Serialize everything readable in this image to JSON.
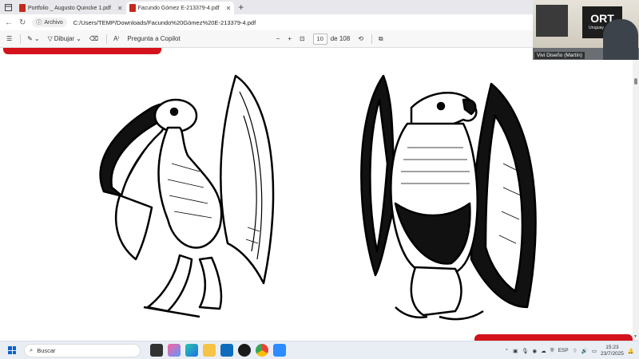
{
  "tabs": [
    {
      "title": "Portfolio _ Augusto Quincke 1.pdf",
      "active": false
    },
    {
      "title": "Facundo Gómez E-213379-4.pdf",
      "active": true
    }
  ],
  "address": {
    "chip_label": "Archivo",
    "url": "C:/Users/TEMP/Downloads/Facundo%20Gómez%20E-213379-4.pdf"
  },
  "pdf_toolbar": {
    "draw_label": "Dibujar",
    "copilot_label": "Pregunta a Copilot",
    "page_current": "10",
    "page_of_label": "de 108"
  },
  "video": {
    "participant_name": "Vivi Diseño (Martín)",
    "logo_text": "ORT",
    "logo_sub": "Uruguay"
  },
  "taskbar": {
    "search_placeholder": "Buscar",
    "language": "ESP",
    "time": "15:23",
    "date": "23/7/2025"
  },
  "colors": {
    "accent_red": "#d3121c",
    "win_blue": "#0a62c9"
  }
}
